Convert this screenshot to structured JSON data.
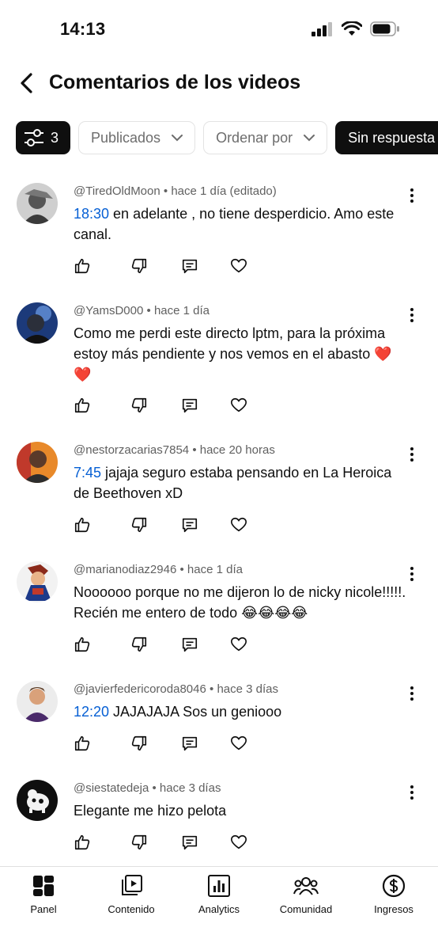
{
  "status_bar": {
    "time": "14:13"
  },
  "header": {
    "title": "Comentarios de los videos"
  },
  "filters": {
    "filter_count": "3",
    "chips": [
      {
        "label": "Publicados"
      },
      {
        "label": "Ordenar por"
      },
      {
        "label": "Sin respuesta"
      }
    ]
  },
  "comments": [
    {
      "author": "@TiredOldMoon",
      "time": "hace 1 día (editado)",
      "timestamp": "18:30",
      "text": " en adelante , no tiene desperdicio. Amo este canal."
    },
    {
      "author": "@YamsD000",
      "time": "hace 1 día",
      "timestamp": "",
      "text": "Como me perdi este directo lptm, para la próxima estoy más pendiente y nos vemos en el abasto ❤️ ❤️"
    },
    {
      "author": "@nestorzacarias7854",
      "time": "hace 20 horas",
      "timestamp": "7:45",
      "text": " jajaja seguro estaba pensando en La Heroica de Beethoven xD"
    },
    {
      "author": "@marianodiaz2946",
      "time": "hace 1 día",
      "timestamp": "",
      "text": "Noooooo porque no me dijeron lo de nicky nicole!!!!!. Recién me entero de todo 😂😂😂😂"
    },
    {
      "author": "@javierfedericoroda8046",
      "time": "hace 3 días",
      "timestamp": "12:20",
      "text": " JAJAJAJA Sos un geniooo"
    },
    {
      "author": "@siestatedeja",
      "time": "hace 3 días",
      "timestamp": "",
      "text": "Elegante me hizo pelota"
    }
  ],
  "meta_separator": "•",
  "bottom_nav": [
    {
      "label": "Panel",
      "icon": "dashboard-icon"
    },
    {
      "label": "Contenido",
      "icon": "content-icon"
    },
    {
      "label": "Analytics",
      "icon": "analytics-icon"
    },
    {
      "label": "Comunidad",
      "icon": "community-icon"
    },
    {
      "label": "Ingresos",
      "icon": "earnings-icon"
    }
  ]
}
